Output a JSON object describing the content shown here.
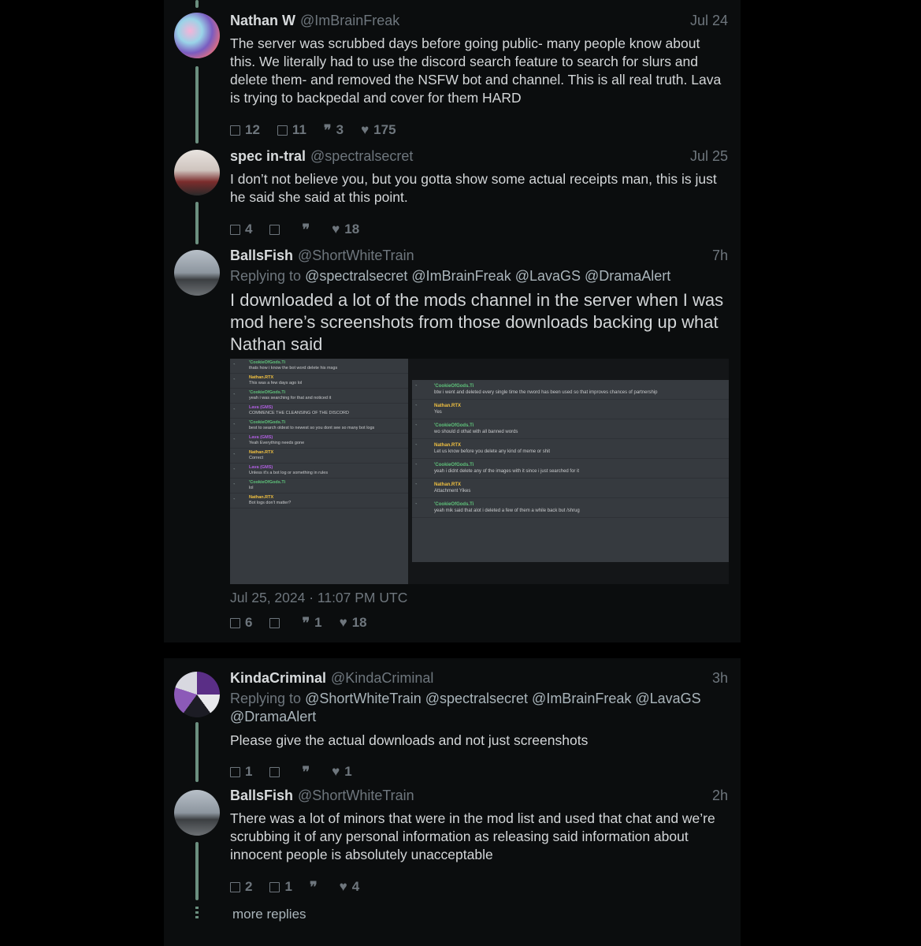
{
  "posts": [
    {
      "name": "Nathan W",
      "handle": "@ImBrainFreak",
      "time": "Jul 24",
      "text": "The server was scrubbed days before going public- many people know about this. We literally had to use the discord search feature to search for slurs and delete them- and removed the NSFW bot and channel. This is all real truth. Lava is trying to backpedal and cover for them HARD",
      "replies": "12",
      "reposts": "11",
      "quotes": "3",
      "likes": "175"
    },
    {
      "name": "spec in-tral",
      "handle": "@spectralsecret",
      "time": "Jul 25",
      "text": "I don’t not believe you, but you gotta show some actual receipts man, this is just he said she said at this point.",
      "replies": "4",
      "reposts": "",
      "quotes": "",
      "likes": "18"
    },
    {
      "name": "BallsFish",
      "handle": "@ShortWhiteTrain",
      "time": "7h",
      "replying_label": "Replying to",
      "replying_to": "@spectralsecret @ImBrainFreak @LavaGS @DramaAlert",
      "text": "I downloaded a lot of the mods channel in the server when I was mod here’s screenshots from those downloads backing up what Nathan said",
      "timestamp": "Jul 25, 2024 · 11:07 PM UTC",
      "replies": "6",
      "reposts": "",
      "quotes": "1",
      "likes": "18"
    },
    {
      "name": "KindaCriminal",
      "handle": "@KindaCriminal",
      "time": "3h",
      "replying_label": "Replying to",
      "replying_to_line1": "@ShortWhiteTrain @spectralsecret @ImBrainFreak @LavaGS",
      "replying_to_line2": "@DramaAlert",
      "text": "Please give the actual downloads and not just screenshots",
      "replies": "1",
      "reposts": "",
      "quotes": "",
      "likes": "1"
    },
    {
      "name": "BallsFish",
      "handle": "@ShortWhiteTrain",
      "time": "2h",
      "text": "There was a lot of minors that were in the mod list and used that chat and we’re scrubbing it of any personal information as releasing said information about innocent people is absolutely unacceptable",
      "replies": "2",
      "reposts": "1",
      "quotes": "",
      "likes": "4"
    }
  ],
  "more_replies": "more replies",
  "colors": {
    "background": "#000000",
    "thread_line": "#6b8f7f",
    "muted": "#6e767d"
  },
  "icons": {
    "reply": "reply-icon",
    "repost": "repost-icon",
    "quote": "quote-icon",
    "like": "heart-icon"
  },
  "screenshot_left": [
    {
      "user": "'CookieOfGods.Ti",
      "text": "thats how i know the bot word delete his msgs"
    },
    {
      "user": "Nathan.RTX",
      "text": "This was a few days ago lol"
    },
    {
      "user": "'CookieOfGods.Ti",
      "text": "yeah i was searching for that and noticed it"
    },
    {
      "user": "Lava (GMS)",
      "text": "COMMENCE THE CLEANSING OF THE DISCORD"
    },
    {
      "user": "'CookieOfGods.Ti",
      "text": "best to search oldest to newest so you dont see so many bot logs"
    },
    {
      "user": "Lava (GMS)",
      "text": "Yeah Everything needs gone"
    },
    {
      "user": "Nathan.RTX",
      "text": "Correct"
    },
    {
      "user": "Lava (GMS)",
      "text": "Unless it's a bot log or something in rules"
    },
    {
      "user": "'CookieOfGods.Ti",
      "text": "lol"
    },
    {
      "user": "Nathan.RTX",
      "text": "Bot logs don't matter?"
    }
  ],
  "screenshot_right": [
    {
      "user": "'CookieOfGods.Ti",
      "text": "btw i went and deleted every single time the nword has been used so that improves chances of partnership"
    },
    {
      "user": "Nathan.RTX",
      "text": "Yes"
    },
    {
      "user": "'CookieOfGods.Ti",
      "text": "wo should d othat with all banned words"
    },
    {
      "user": "Nathan.RTX",
      "text": "Let us know before you delete any kind of meme or shit"
    },
    {
      "user": "'CookieOfGods.Ti",
      "text": "yeah i didnt delete any of the images with it since i just searched for it"
    },
    {
      "user": "Nathan.RTX",
      "text": "Attachment Yikes"
    },
    {
      "user": "'CookieOfGods.Ti",
      "text": "yeah mik said that alot i deleted a few of them a while back but /shrug"
    }
  ]
}
